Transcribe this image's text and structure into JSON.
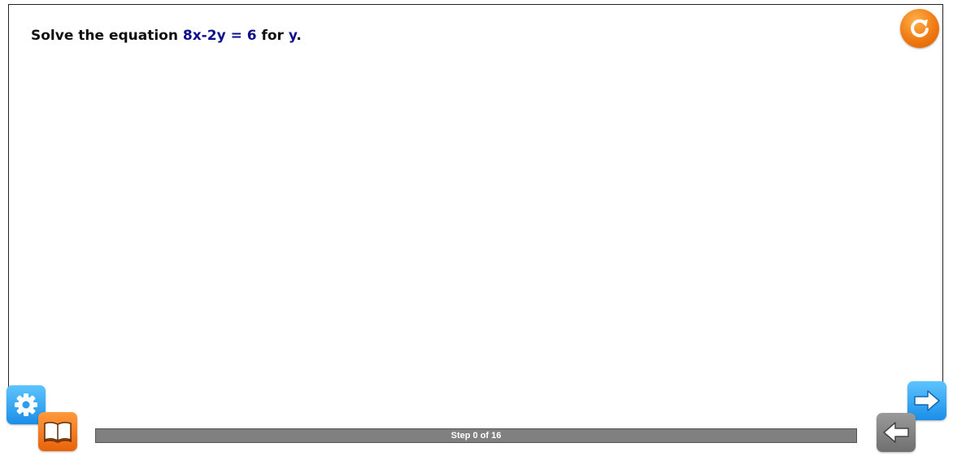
{
  "problem": {
    "prefix": "Solve the equation ",
    "equation": "8x-2y = 6",
    "middle": " for ",
    "variable": "y",
    "suffix": "."
  },
  "progress": {
    "label": "Step 0 of 16",
    "current_step": 0,
    "total_steps": 16,
    "fraction": 0.0
  },
  "buttons": {
    "reset_icon": "refresh-icon",
    "settings_icon": "gear-icon",
    "book_icon": "open-book-icon",
    "next_icon": "right-arrow-icon",
    "prev_icon": "left-arrow-icon"
  },
  "colors": {
    "math_text": "#0f0f8c",
    "reset": "#f07a12",
    "settings": "#1a8fe8",
    "book": "#e8620c",
    "next": "#1a8fe8",
    "prev": "#6f6f6f",
    "progress_track": "#808080"
  }
}
